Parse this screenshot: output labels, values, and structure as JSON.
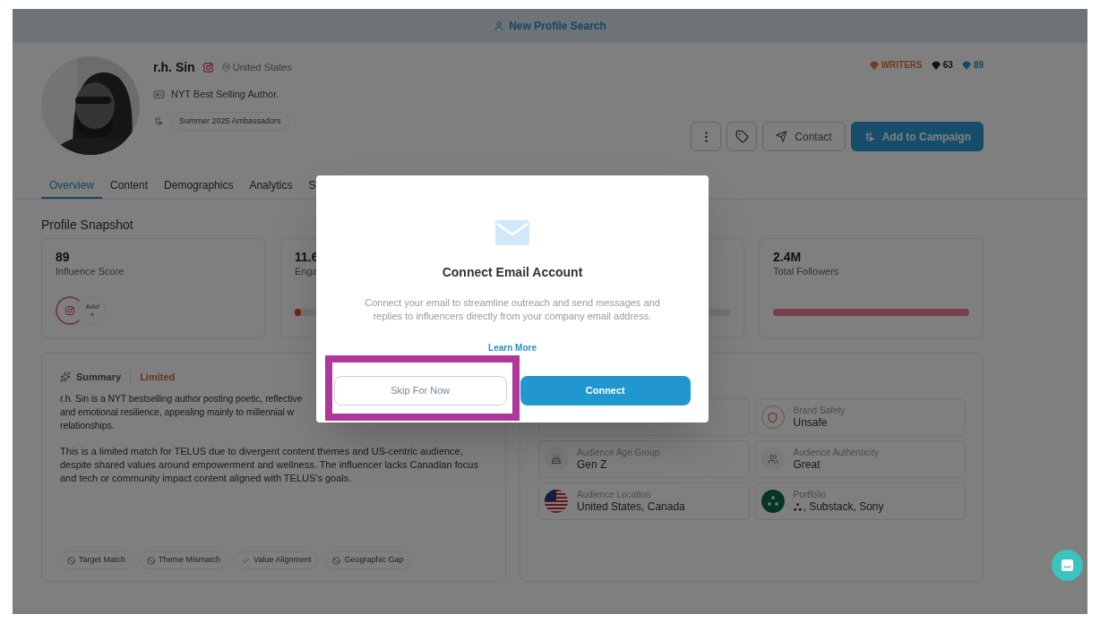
{
  "top_bar": {
    "link": "New Profile Search"
  },
  "profile": {
    "name": "r.h. Sin",
    "location": "United States",
    "bio": "NYT Best Selling Author.",
    "campaign_tag": "Summer 2025 Ambassadors",
    "category": "WRITERS",
    "score_dark": "63",
    "score_blue": "89"
  },
  "actions": [
    {
      "kind": "more"
    },
    {
      "kind": "tag"
    },
    {
      "kind": "contact",
      "label": "Contact"
    },
    {
      "kind": "primary",
      "label": "Add to Campaign"
    }
  ],
  "tabs": [
    {
      "label": "Overview",
      "selected": true
    },
    {
      "label": "Content",
      "selected": false
    },
    {
      "label": "Demographics",
      "selected": false
    },
    {
      "label": "Analytics",
      "selected": false
    },
    {
      "label": "S",
      "selected": false
    }
  ],
  "snapshot": {
    "title": "Profile Snapshot",
    "cards": [
      {
        "kind": "score",
        "value": "89",
        "label": "Influence Score",
        "add_label": "Add",
        "add_sign": "+"
      },
      {
        "kind": "rate",
        "value": "11.6",
        "label": "Enga",
        "level": 0.03
      },
      {
        "kind": "track"
      },
      {
        "kind": "reach",
        "value": "2.4M",
        "label": "Total Followers",
        "level": 1
      }
    ]
  },
  "summary": {
    "title": "Summary",
    "match": "Limited",
    "paragraph_lines": [
      "r.h. Sin is a NYT bestselling author posting poetic, reflective",
      "and emotional resilience, appealing mainly to millennial w",
      "relationships."
    ],
    "paragraph": "This is a limited match for TELUS due to divergent content themes and US-centric audience, despite shared values around empowerment and wellness. The influencer lacks Canadian focus and tech or community impact content aligned with TELUS's goals.",
    "chips": [
      {
        "kind": "ban",
        "label": "Target Match"
      },
      {
        "kind": "ban",
        "label": "Theme Mismatch"
      },
      {
        "kind": "check",
        "label": "Value Alignment"
      },
      {
        "kind": "ban",
        "label": "Geographic Gap"
      }
    ]
  },
  "details": [
    {
      "kind": "covered"
    },
    {
      "kind": "shield",
      "label": "Brand Safety",
      "value": "Unsafe"
    },
    {
      "kind": "cake",
      "label": "Audience Age Group",
      "value": "Gen Z"
    },
    {
      "kind": "people",
      "label": "Audience Authenticity",
      "value": "Great"
    },
    {
      "kind": "flag",
      "label": "Audience Location",
      "value": "United States, Canada"
    },
    {
      "kind": "portfolio",
      "label": "Portfolio",
      "value": ", Substack, Sony"
    }
  ],
  "modal": {
    "title": "Connect Email Account",
    "description": "Connect your email to streamline outreach and send messages and replies to influencers directly from your company email address.",
    "link": "Learn More",
    "buttons": [
      {
        "kind": "secondary",
        "label": "Skip For Now",
        "highlighted": true
      },
      {
        "kind": "primary",
        "label": "Connect"
      }
    ]
  }
}
